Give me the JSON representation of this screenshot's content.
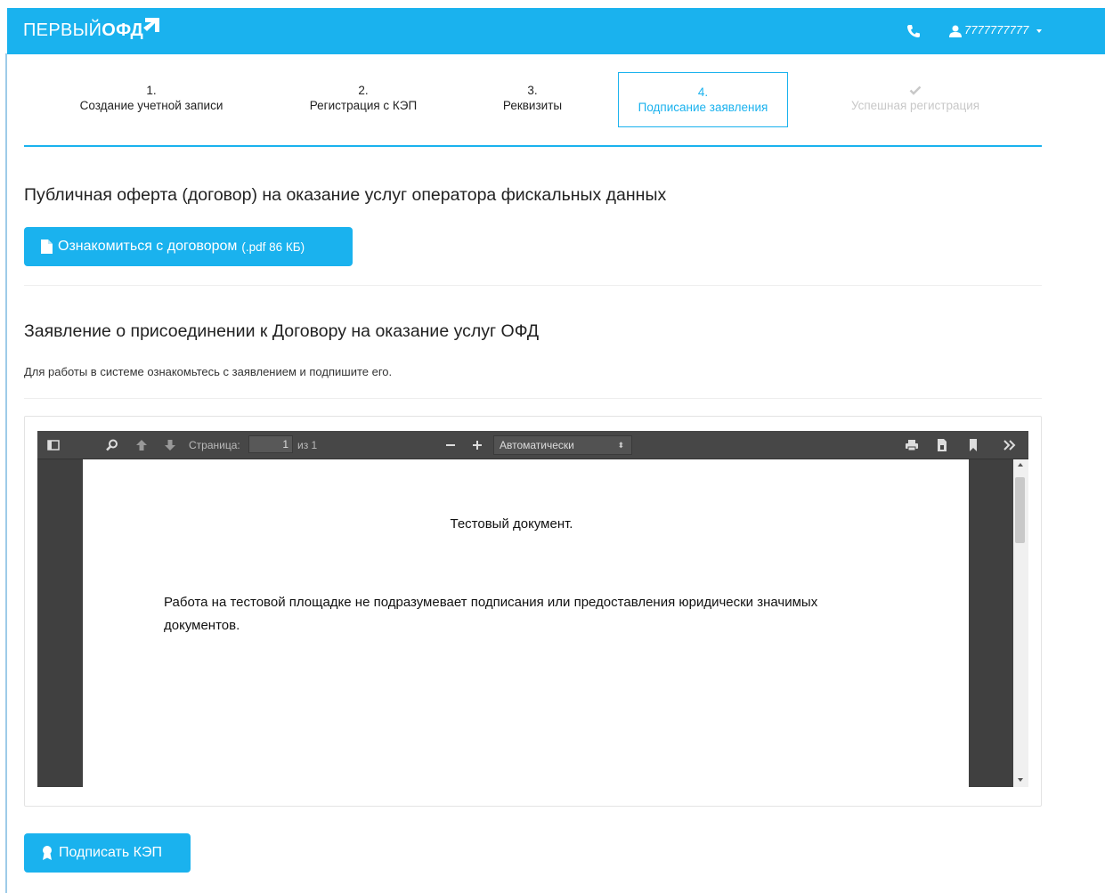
{
  "header": {
    "logo_text_regular": "ПЕРВЫЙ",
    "logo_text_bold": "ОФД",
    "user_phone": "7777777777",
    "accent_color": "#1ab2ee"
  },
  "steps": [
    {
      "number": "1.",
      "label": "Создание учетной записи",
      "state": "done"
    },
    {
      "number": "2.",
      "label": "Регистрация с КЭП",
      "state": "done"
    },
    {
      "number": "3.",
      "label": "Реквизиты",
      "state": "done"
    },
    {
      "number": "4.",
      "label": "Подписание заявления",
      "state": "active"
    },
    {
      "number": "",
      "label": "Успешная регистрация",
      "state": "disabled",
      "icon": "check-icon"
    }
  ],
  "offer": {
    "title": "Публичная оферта (договор) на оказание услуг оператора фискальных данных",
    "button_label": "Ознакомиться с договором",
    "button_meta": "(.pdf 86 КБ)",
    "button_icon": "file-icon"
  },
  "statement": {
    "title": "Заявление о присоединении к Договору на оказание услуг ОФД",
    "hint": "Для работы в системе ознакомьтесь с заявлением и подпишите его."
  },
  "pdf_viewer": {
    "page_label": "Страница:",
    "page_value": "1",
    "page_total": "из 1",
    "zoom_value": "Автоматически",
    "doc_title": "Тестовый документ.",
    "doc_body": "Работа на тестовой площадке не подразумевает подписания или предоставления юридически значимых документов."
  },
  "sign": {
    "button_label": "Подписать КЭП",
    "button_icon": "award-icon"
  }
}
